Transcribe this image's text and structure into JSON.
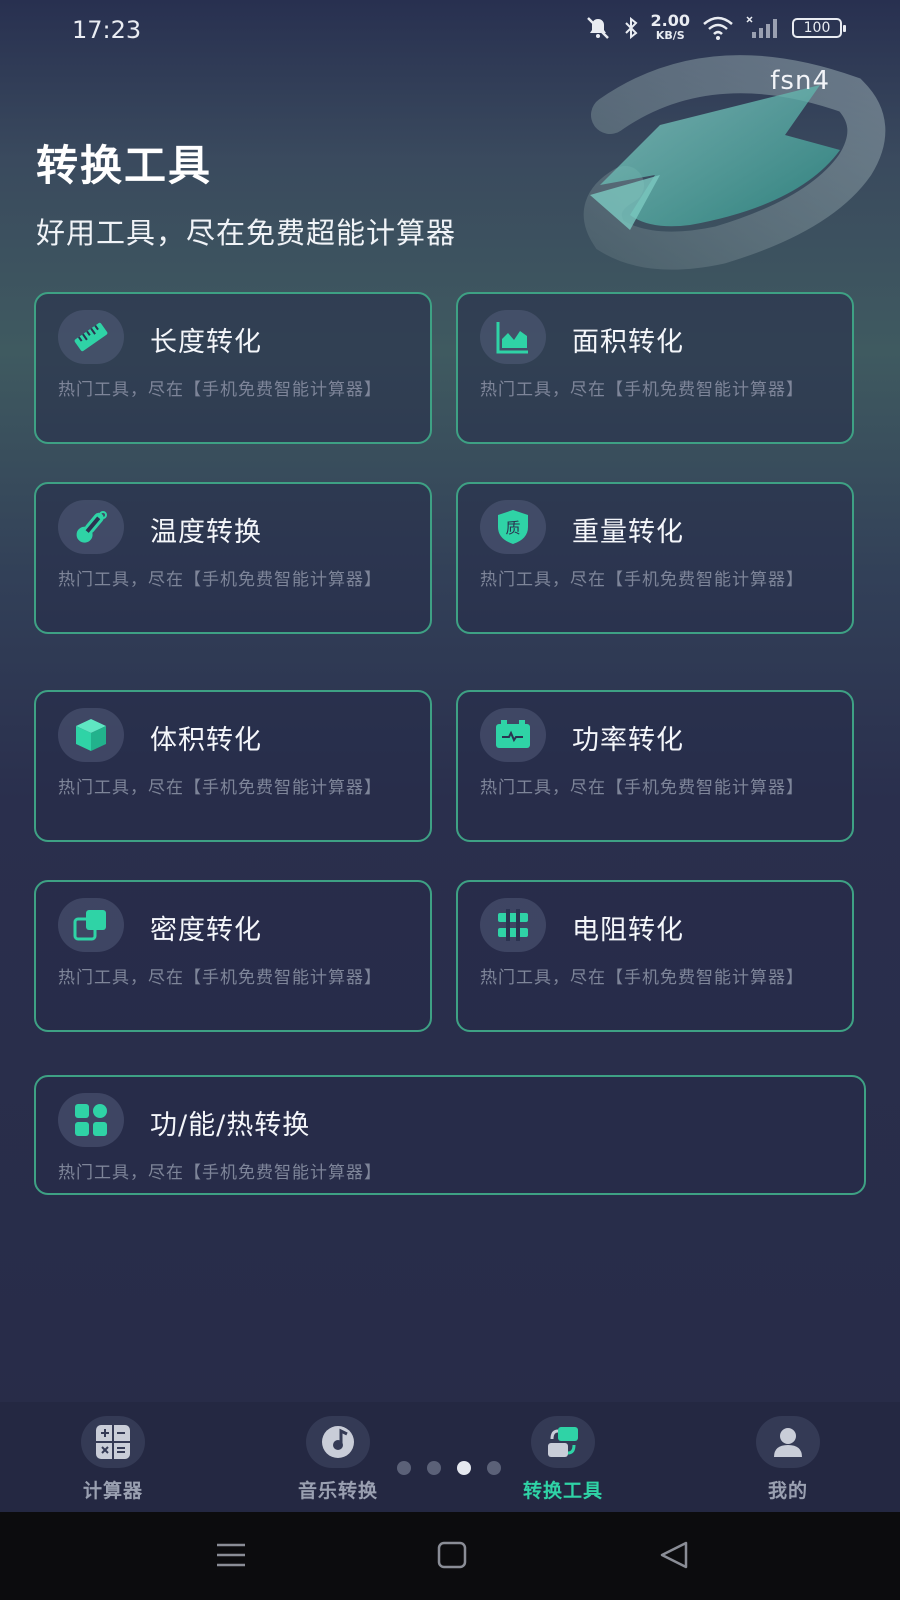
{
  "status_bar": {
    "time": "17:23",
    "network_speed_value": "2.00",
    "network_speed_unit": "KB/S",
    "battery": "100",
    "icons": [
      "mute-icon",
      "bluetooth-icon",
      "wifi-icon",
      "signal-icon"
    ]
  },
  "header": {
    "user": "fsn4",
    "title": "转换工具",
    "subtitle": "好用工具，尽在免费超能计算器"
  },
  "tools": [
    {
      "title": "长度转化",
      "desc": "热门工具，尽在【手机免费智能计算器】",
      "icon": "ruler-icon"
    },
    {
      "title": "面积转化",
      "desc": "热门工具，尽在【手机免费智能计算器】",
      "icon": "area-chart-icon"
    },
    {
      "title": "温度转换",
      "desc": "热门工具，尽在【手机免费智能计算器】",
      "icon": "thermometer-icon"
    },
    {
      "title": "重量转化",
      "desc": "热门工具，尽在【手机免费智能计算器】",
      "icon": "weight-badge-icon",
      "icon_text": "质"
    },
    {
      "title": "体积转化",
      "desc": "热门工具，尽在【手机免费智能计算器】",
      "icon": "cube-icon"
    },
    {
      "title": "功率转化",
      "desc": "热门工具，尽在【手机免费智能计算器】",
      "icon": "battery-pulse-icon"
    },
    {
      "title": "密度转化",
      "desc": "热门工具，尽在【手机免费智能计算器】",
      "icon": "layers-icon"
    },
    {
      "title": "电阻转化",
      "desc": "热门工具，尽在【手机免费智能计算器】",
      "icon": "resistor-icon"
    },
    {
      "title": "功/能/热转换",
      "desc": "热门工具，尽在【手机免费智能计算器】",
      "icon": "grid-icon"
    }
  ],
  "bottom_nav": [
    {
      "label": "计算器",
      "icon": "calculator-icon",
      "active": false
    },
    {
      "label": "音乐转换",
      "icon": "music-disc-icon",
      "active": false
    },
    {
      "label": "转换工具",
      "icon": "convert-icon",
      "active": true
    },
    {
      "label": "我的",
      "icon": "profile-icon",
      "active": false
    }
  ],
  "pager": {
    "count": 4,
    "active_index": 2
  },
  "colors": {
    "accent": "#2fd3a6",
    "card_border": "#3ea184",
    "background": "#272b47",
    "muted_text": "#7e8599"
  }
}
